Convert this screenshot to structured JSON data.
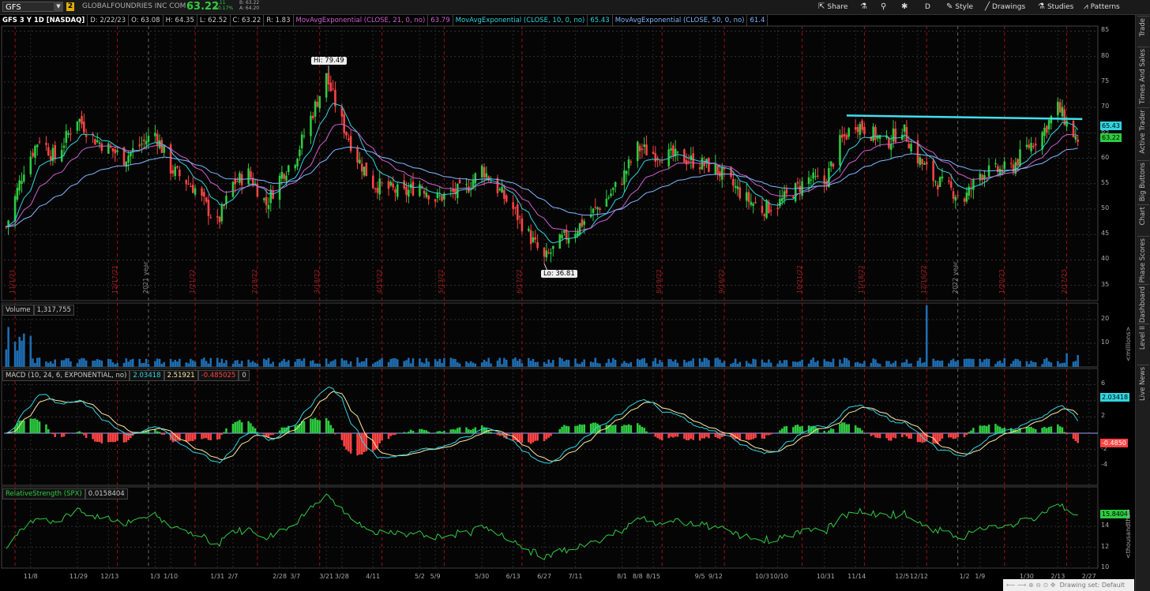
{
  "toolbar": {
    "symbol": "GFS",
    "link_badge": "2",
    "company": "GLOBALFOUNDRIES INC COM",
    "last_price": "63.22",
    "change_abs": "+.11",
    "change_pct": "+0.17%",
    "bid": "B: 63.22",
    "ask": "A: 64.20",
    "share_label": "Share",
    "period_label": "D",
    "style_label": "Style",
    "drawings_label": "Drawings",
    "studies_label": "Studies",
    "patterns_label": "Patterns"
  },
  "infobar": {
    "title": "GFS 3 Y 1D [NASDAQ]",
    "date": "D: 2/22/23",
    "open": "O: 63.08",
    "high": "H: 64.35",
    "low": "L: 62.52",
    "close": "C: 63.22",
    "range": "R: 1.83",
    "ema21_label": "MovAvgExponential (CLOSE, 21, 0, no)",
    "ema21_value": "63.79",
    "ema10_label": "MovAvgExponential (CLOSE, 10, 0, no)",
    "ema10_value": "65.43",
    "ema50_label": "MovAvgExponential (CLOSE, 50, 0, no)",
    "ema50_value": "61.4"
  },
  "price_panel": {
    "hi_label": "Hi: 79.49",
    "lo_label": "Lo: 36.81",
    "tag_ema10": "65.43",
    "tag_last": "63.22",
    "y_ticks": [
      "35",
      "40",
      "45",
      "50",
      "55",
      "60",
      "65",
      "70",
      "75",
      "80",
      "85"
    ],
    "period_markers": [
      "11/1/21",
      "12/17/21",
      "2021 year",
      "1/21/22",
      "2/18/22",
      "3/18/22",
      "4/15/22",
      "5/13/22",
      "6/17/22",
      "8/19/22",
      "9/16/22",
      "10/21/22",
      "11/18/22",
      "12/16/22",
      "2022 year",
      "1/20/23",
      "2/17/23"
    ]
  },
  "volume_panel": {
    "label": "Volume",
    "value": "1,317,755",
    "unit": "<millions>",
    "y_ticks": [
      "10",
      "20"
    ]
  },
  "macd_panel": {
    "label": "MACD (10, 24, 6, EXPONENTIAL, no)",
    "value": "2.03418",
    "avg": "2.51921",
    "diff": "-0.485025",
    "zero": "0",
    "tag_value": "2.03418",
    "tag_diff": "-0.4850",
    "y_ticks": [
      "-4",
      "-2",
      "2",
      "4",
      "6"
    ]
  },
  "rs_panel": {
    "label": "RelativeStrength (SPX)",
    "value": "0.0158404",
    "tag_value": "15.8404",
    "unit": "<thousandths>",
    "y_ticks": [
      "10",
      "12",
      "14"
    ]
  },
  "x_axis": [
    "11/8",
    "11/29",
    "12/13",
    "1/3",
    "1/10",
    "1/31",
    "2/7",
    "2/28",
    "3/7",
    "3/21",
    "3/28",
    "4/11",
    "5/2",
    "5/9",
    "5/30",
    "6/13",
    "6/27",
    "7/11",
    "8/1",
    "8/8",
    "8/15",
    "9/5",
    "9/12",
    "10/3",
    "10/10",
    "10/31",
    "11/14",
    "12/5",
    "12/12",
    "1/2",
    "1/9",
    "1/30",
    "2/13",
    "2/27"
  ],
  "sidebar_tabs": [
    "Trade",
    "Times And Sales",
    "Active Trader",
    "Big Buttons",
    "Chart",
    "Phase Scores",
    "Dashboard",
    "Level II",
    "Live News"
  ],
  "status": "Drawing set: Default",
  "colors": {
    "up": "#2ecc40",
    "down": "#ff4444",
    "ema10": "#30d5e0",
    "ema21": "#d060d0",
    "ema50": "#80b8ff",
    "resistance": "#40e0f0"
  },
  "chart_data": {
    "type": "candlestick",
    "price_range": [
      32,
      86
    ],
    "resistance_line": {
      "from_date": "11/10/22",
      "to_date": "2/24/23",
      "from": 68.4,
      "to": 67.7
    },
    "close_keypoints": [
      {
        "date": "10/28/21",
        "close": 46.5
      },
      {
        "date": "11/5/21",
        "close": 58
      },
      {
        "date": "11/12/21",
        "close": 64
      },
      {
        "date": "11/19/21",
        "close": 60
      },
      {
        "date": "11/29/21",
        "close": 68
      },
      {
        "date": "12/6/21",
        "close": 64
      },
      {
        "date": "12/13/21",
        "close": 62
      },
      {
        "date": "12/20/21",
        "close": 60
      },
      {
        "date": "1/3/22",
        "close": 65
      },
      {
        "date": "1/10/22",
        "close": 58
      },
      {
        "date": "1/21/22",
        "close": 54
      },
      {
        "date": "1/31/22",
        "close": 47
      },
      {
        "date": "2/7/22",
        "close": 55
      },
      {
        "date": "2/14/22",
        "close": 57
      },
      {
        "date": "2/22/22",
        "close": 51
      },
      {
        "date": "3/1/22",
        "close": 57
      },
      {
        "date": "3/7/22",
        "close": 60
      },
      {
        "date": "3/14/22",
        "close": 68
      },
      {
        "date": "3/21/22",
        "close": 76
      },
      {
        "date": "3/28/22",
        "close": 67
      },
      {
        "date": "4/4/22",
        "close": 60
      },
      {
        "date": "4/11/22",
        "close": 55
      },
      {
        "date": "4/25/22",
        "close": 53
      },
      {
        "date": "5/2/22",
        "close": 55
      },
      {
        "date": "5/9/22",
        "close": 52
      },
      {
        "date": "5/23/22",
        "close": 54
      },
      {
        "date": "5/30/22",
        "close": 58
      },
      {
        "date": "6/13/22",
        "close": 50
      },
      {
        "date": "6/20/22",
        "close": 45
      },
      {
        "date": "6/27/22",
        "close": 40
      },
      {
        "date": "7/5/22",
        "close": 44
      },
      {
        "date": "7/11/22",
        "close": 46
      },
      {
        "date": "7/25/22",
        "close": 52
      },
      {
        "date": "8/1/22",
        "close": 56
      },
      {
        "date": "8/8/22",
        "close": 62
      },
      {
        "date": "8/15/22",
        "close": 61
      },
      {
        "date": "8/29/22",
        "close": 60
      },
      {
        "date": "9/5/22",
        "close": 59
      },
      {
        "date": "9/12/22",
        "close": 58
      },
      {
        "date": "9/26/22",
        "close": 52
      },
      {
        "date": "10/3/22",
        "close": 50
      },
      {
        "date": "10/10/22",
        "close": 51
      },
      {
        "date": "10/24/22",
        "close": 56
      },
      {
        "date": "10/31/22",
        "close": 55
      },
      {
        "date": "11/7/22",
        "close": 63
      },
      {
        "date": "11/14/22",
        "close": 67
      },
      {
        "date": "11/28/22",
        "close": 63
      },
      {
        "date": "12/5/22",
        "close": 66
      },
      {
        "date": "12/12/22",
        "close": 60
      },
      {
        "date": "12/19/22",
        "close": 56
      },
      {
        "date": "1/2/23",
        "close": 52
      },
      {
        "date": "1/9/23",
        "close": 57
      },
      {
        "date": "1/23/23",
        "close": 58
      },
      {
        "date": "1/30/23",
        "close": 62
      },
      {
        "date": "2/6/23",
        "close": 65
      },
      {
        "date": "2/13/23",
        "close": 70
      },
      {
        "date": "2/22/23",
        "close": 63.2
      }
    ]
  }
}
